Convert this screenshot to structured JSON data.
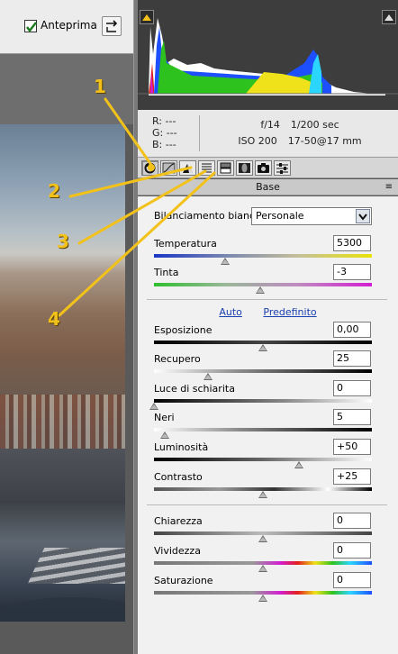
{
  "toolbar": {
    "preview_label": "Anteprima",
    "preview_checked": true
  },
  "info": {
    "r": "R:",
    "g": "G:",
    "b": "B:",
    "r_val": "---",
    "g_val": "---",
    "b_val": "---",
    "aperture": "f/14",
    "shutter": "1/200 sec",
    "iso": "ISO 200",
    "lens": "17-50@17 mm"
  },
  "tabs": [
    {
      "icon": "basic-icon"
    },
    {
      "icon": "tone-curve-icon"
    },
    {
      "icon": "detail-icon"
    },
    {
      "icon": "hsl-icon"
    },
    {
      "icon": "split-toning-icon"
    },
    {
      "icon": "lens-icon"
    },
    {
      "icon": "camera-calibration-icon"
    },
    {
      "icon": "presets-icon"
    }
  ],
  "panel": {
    "title": "Base",
    "menu": "≡"
  },
  "wb": {
    "label": "Bilanciamento bianco:",
    "value": "Personale"
  },
  "links": {
    "auto": "Auto",
    "default": "Predefinito"
  },
  "sliders": {
    "temperature": {
      "label": "Temperatura",
      "value": "5300"
    },
    "tint": {
      "label": "Tinta",
      "value": "-3"
    },
    "exposure": {
      "label": "Esposizione",
      "value": "0,00"
    },
    "recovery": {
      "label": "Recupero",
      "value": "25"
    },
    "fill_light": {
      "label": "Luce di schiarita",
      "value": "0"
    },
    "blacks": {
      "label": "Neri",
      "value": "5"
    },
    "brightness": {
      "label": "Luminosità",
      "value": "+50"
    },
    "contrast": {
      "label": "Contrasto",
      "value": "+25"
    },
    "clarity": {
      "label": "Chiarezza",
      "value": "0"
    },
    "vibrance": {
      "label": "Vividezza",
      "value": "0"
    },
    "saturation": {
      "label": "Saturazione",
      "value": "0"
    }
  },
  "callouts": {
    "one": "1",
    "two": "2",
    "three": "3",
    "four": "4"
  },
  "colors": {
    "accent": "#f2c21b",
    "link": "#1a3fb0"
  }
}
